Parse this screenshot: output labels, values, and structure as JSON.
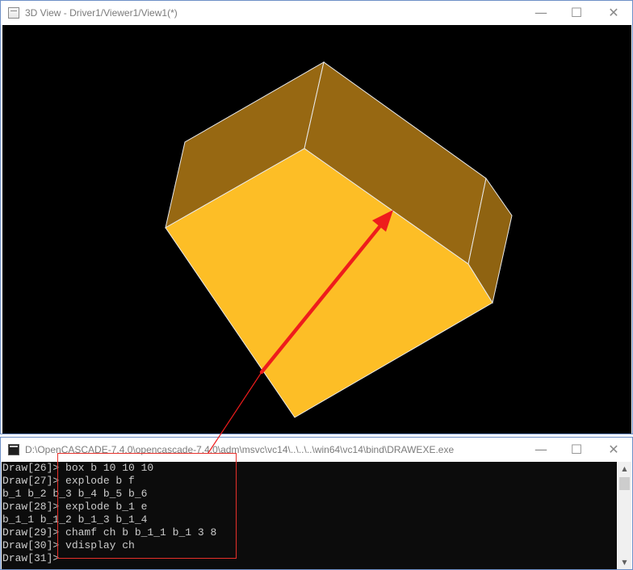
{
  "viewer_window": {
    "title": "3D View - Driver1/Viewer1/View1(*)",
    "icon": "app-window-icon",
    "controls": {
      "minimize": "—",
      "maximize": "☐",
      "close": "✕"
    },
    "viewport_background": "#000000",
    "shape_colors": {
      "top_face": "#fdbe26",
      "side_face": "#976812",
      "edge": "#e9e9e9"
    }
  },
  "console_window": {
    "title": "D:\\OpenCASCADE-7.4.0\\opencascade-7.4.0\\adm\\msvc\\vc14\\..\\..\\..\\win64\\vc14\\bind\\DRAWEXE.exe",
    "icon": "console-window-icon",
    "controls": {
      "minimize": "—",
      "maximize": "☐",
      "close": "✕"
    },
    "lines": [
      {
        "prompt": "Draw[26]>",
        "text": " box b 10 10 10"
      },
      {
        "prompt": "Draw[27]>",
        "text": " explode b f"
      },
      {
        "prompt": "",
        "text": "b_1 b_2 b_3 b_4 b_5 b_6"
      },
      {
        "prompt": "Draw[28]>",
        "text": " explode b_1 e"
      },
      {
        "prompt": "",
        "text": "b_1_1 b_1_2 b_1_3 b_1_4"
      },
      {
        "prompt": "Draw[29]>",
        "text": " chamf ch b b_1_1 b_1 3 8"
      },
      {
        "prompt": "Draw[30]>",
        "text": " vdisplay ch"
      },
      {
        "prompt": "Draw[31]>",
        "text": ""
      }
    ],
    "scrollbar": {
      "up": "▲",
      "down": "▼"
    }
  },
  "annotation": {
    "color": "#e8302a",
    "arrow_color": "#ee1c1c"
  }
}
